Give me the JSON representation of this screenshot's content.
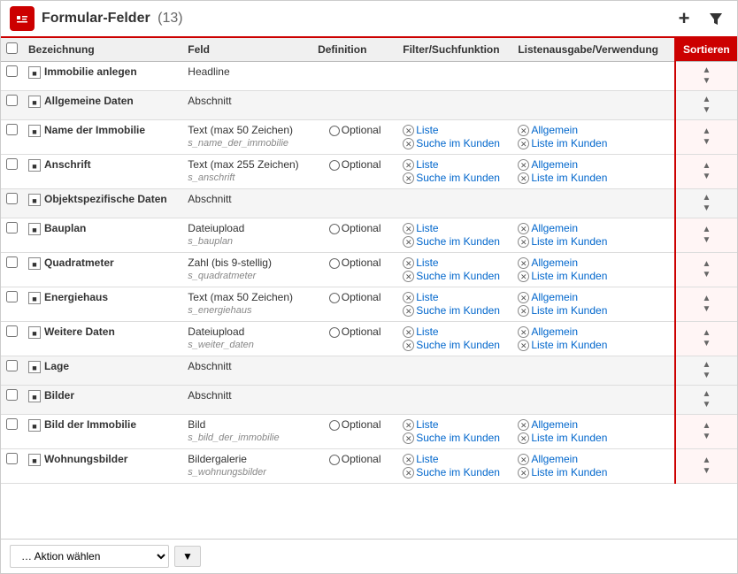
{
  "header": {
    "title": "Formular-Felder",
    "count": "(13)",
    "add_label": "+",
    "filter_label": "▼"
  },
  "columns": {
    "checkbox": "",
    "bezeichnung": "Bezeichnung",
    "feld": "Feld",
    "definition": "Definition",
    "filter": "Filter/Suchfunktion",
    "listen": "Listenausgabe/Verwendung",
    "sortieren": "Sortieren"
  },
  "rows": [
    {
      "id": 1,
      "type": "normal",
      "bezeichnung": "Immobilie anlegen",
      "feld": "Headline",
      "definition": "",
      "filter": [],
      "listen": []
    },
    {
      "id": 2,
      "type": "abschnitt",
      "bezeichnung": "Allgemeine Daten",
      "feld": "Abschnitt",
      "definition": "",
      "filter": [],
      "listen": []
    },
    {
      "id": 3,
      "type": "normal",
      "bezeichnung": "Name der Immobilie",
      "feld": "Text (max 50 Zeichen)",
      "feld_sub": "s_name_der_immobilie",
      "definition": "Optional",
      "filter": [
        "Liste",
        "Suche im Kunden"
      ],
      "listen": [
        "Allgemein",
        "Liste im Kunden"
      ]
    },
    {
      "id": 4,
      "type": "normal",
      "bezeichnung": "Anschrift",
      "feld": "Text (max 255 Zeichen)",
      "feld_sub": "s_anschrift",
      "definition": "Optional",
      "filter": [
        "Liste",
        "Suche im Kunden"
      ],
      "listen": [
        "Allgemein",
        "Liste im Kunden"
      ]
    },
    {
      "id": 5,
      "type": "abschnitt",
      "bezeichnung": "Objektspezifische Daten",
      "feld": "Abschnitt",
      "definition": "",
      "filter": [],
      "listen": []
    },
    {
      "id": 6,
      "type": "normal",
      "bezeichnung": "Bauplan",
      "feld": "Dateiupload",
      "feld_sub": "s_bauplan",
      "definition": "Optional",
      "filter": [
        "Liste",
        "Suche im Kunden"
      ],
      "listen": [
        "Allgemein",
        "Liste im Kunden"
      ]
    },
    {
      "id": 7,
      "type": "normal",
      "bezeichnung": "Quadratmeter",
      "feld": "Zahl (bis 9-stellig)",
      "feld_sub": "s_quadratmeter",
      "definition": "Optional",
      "filter": [
        "Liste",
        "Suche im Kunden"
      ],
      "listen": [
        "Allgemein",
        "Liste im Kunden"
      ]
    },
    {
      "id": 8,
      "type": "normal",
      "bezeichnung": "Energiehaus",
      "feld": "Text (max 50 Zeichen)",
      "feld_sub": "s_energiehaus",
      "definition": "Optional",
      "filter": [
        "Liste",
        "Suche im Kunden"
      ],
      "listen": [
        "Allgemein",
        "Liste im Kunden"
      ]
    },
    {
      "id": 9,
      "type": "normal",
      "bezeichnung": "Weitere Daten",
      "feld": "Dateiupload",
      "feld_sub": "s_weiter_daten",
      "definition": "Optional",
      "filter": [
        "Liste",
        "Suche im Kunden"
      ],
      "listen": [
        "Allgemein",
        "Liste im Kunden"
      ]
    },
    {
      "id": 10,
      "type": "abschnitt",
      "bezeichnung": "Lage",
      "feld": "Abschnitt",
      "definition": "",
      "filter": [],
      "listen": []
    },
    {
      "id": 11,
      "type": "abschnitt",
      "bezeichnung": "Bilder",
      "feld": "Abschnitt",
      "definition": "",
      "filter": [],
      "listen": []
    },
    {
      "id": 12,
      "type": "normal",
      "bezeichnung": "Bild der Immobilie",
      "feld": "Bild",
      "feld_sub": "s_bild_der_immobilie",
      "definition": "Optional",
      "filter": [
        "Liste",
        "Suche im Kunden"
      ],
      "listen": [
        "Allgemein",
        "Liste im Kunden"
      ]
    },
    {
      "id": 13,
      "type": "normal",
      "bezeichnung": "Wohnungsbilder",
      "feld": "Bildergalerie",
      "feld_sub": "s_wohnungsbilder",
      "definition": "Optional",
      "filter": [
        "Liste",
        "Suche im Kunden"
      ],
      "listen": [
        "Allgemein",
        "Liste im Kunden"
      ]
    }
  ],
  "footer": {
    "action_placeholder": "… Aktion wählen",
    "go_label": "▼"
  }
}
